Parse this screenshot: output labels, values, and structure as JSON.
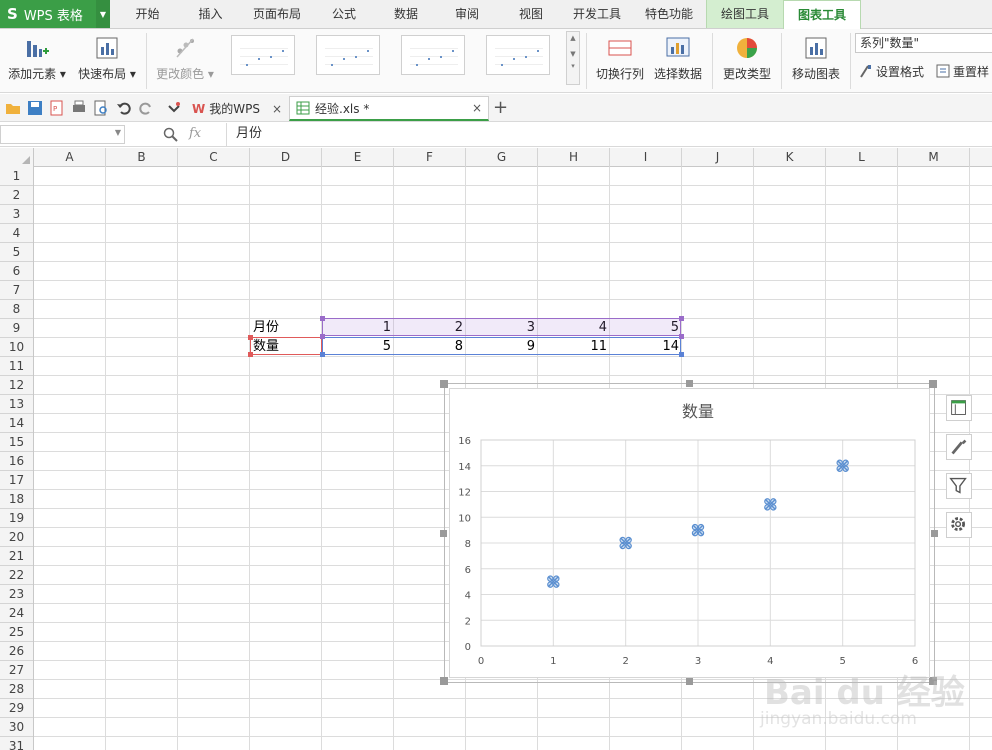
{
  "app": {
    "logo": "S",
    "name": "WPS 表格"
  },
  "menu": {
    "tabs": [
      "开始",
      "插入",
      "页面布局",
      "公式",
      "数据",
      "审阅",
      "视图",
      "开发工具",
      "特色功能",
      "绘图工具",
      "图表工具"
    ],
    "active": "图表工具"
  },
  "ribbon": {
    "add_element": "添加元素",
    "quick_layout": "快速布局",
    "change_color": "更改颜色",
    "switch_rows_cols": "切换行列",
    "select_data": "选择数据",
    "change_type": "更改类型",
    "move_chart": "移动图表",
    "series_selector": "系列\"数量\"",
    "set_format": "设置格式",
    "reset_style": "重置样"
  },
  "tabs": {
    "mywps": "我的WPS",
    "file": "经验.xls *",
    "close": "×",
    "new": "+"
  },
  "formula_bar": {
    "name_box": "",
    "fx": "fx",
    "content": "月份"
  },
  "columns": [
    "A",
    "B",
    "C",
    "D",
    "E",
    "F",
    "G",
    "H",
    "I",
    "J",
    "K",
    "L",
    "M"
  ],
  "rows": [
    "1",
    "2",
    "3",
    "4",
    "5",
    "6",
    "7",
    "8",
    "9",
    "10",
    "11",
    "12",
    "13",
    "14",
    "15",
    "16",
    "17",
    "18",
    "19",
    "20",
    "21",
    "22",
    "23",
    "24",
    "25",
    "26",
    "27",
    "28",
    "29",
    "30",
    "31"
  ],
  "sheet": {
    "label_month": "月份",
    "label_qty": "数量",
    "months": [
      "1",
      "2",
      "3",
      "4",
      "5"
    ],
    "quantities": [
      "5",
      "8",
      "9",
      "11",
      "14"
    ]
  },
  "watermark": {
    "text": "Bai du 经验",
    "url": "jingyan.baidu.com"
  },
  "colors": {
    "accent_green": "#3b9e47",
    "marker_blue": "#5b8fd0",
    "range_purple": "#9a6cc9",
    "range_blue": "#5b82d6",
    "range_red": "#e05a5a"
  },
  "chart_data": {
    "type": "scatter",
    "title": "数量",
    "x": [
      1,
      2,
      3,
      4,
      5
    ],
    "y": [
      5,
      8,
      9,
      11,
      14
    ],
    "xlim": [
      0,
      6
    ],
    "ylim": [
      0,
      16
    ],
    "xticks": [
      0,
      1,
      2,
      3,
      4,
      5,
      6
    ],
    "yticks": [
      0,
      2,
      4,
      6,
      8,
      10,
      12,
      14,
      16
    ],
    "grid": true,
    "legend": "none"
  }
}
